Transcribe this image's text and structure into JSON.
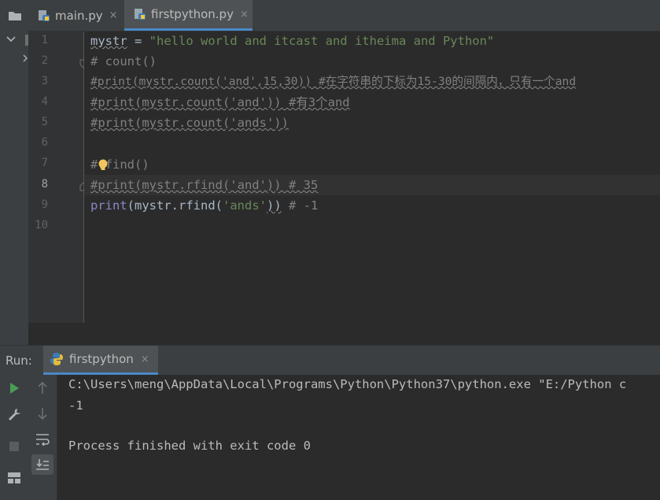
{
  "tabs": [
    {
      "label": "main.py",
      "close": "×"
    },
    {
      "label": "firstpython.py",
      "close": "×"
    }
  ],
  "editor": {
    "line_numbers": [
      "1",
      "2",
      "3",
      "4",
      "5",
      "6",
      "7",
      "8",
      "9",
      "10"
    ],
    "lines": {
      "l1_var": "mystr",
      "l1_eq": " = ",
      "l1_str": "\"hello world and itcast and itheima and Python\"",
      "l2": "# count()",
      "l3": "#print(mystr.count('and',15,30)) #在字符串的下标为15-30的间隔内，只有一个and",
      "l4": "#print(mystr.count('and')) #有3个and",
      "l5": "#print(mystr.count('ands'))",
      "l7": "#rfind()",
      "l8": "#print(mystr.rfind('and')) # 35",
      "l9_fn": "print",
      "l9_a": "(mystr.rfind(",
      "l9_str": "'ands'",
      "l9_b": "))",
      "l9_cm": " # -1"
    }
  },
  "run": {
    "label": "Run:",
    "tab_label": "firstpython",
    "tab_close": "×",
    "console": [
      "C:\\Users\\meng\\AppData\\Local\\Programs\\Python\\Python37\\python.exe \"E:/Python c",
      "-1",
      "",
      "Process finished with exit code 0"
    ]
  },
  "colors": {
    "accent": "#4a88c7",
    "run_green": "#499c54",
    "bulb": "#f2c55c"
  }
}
